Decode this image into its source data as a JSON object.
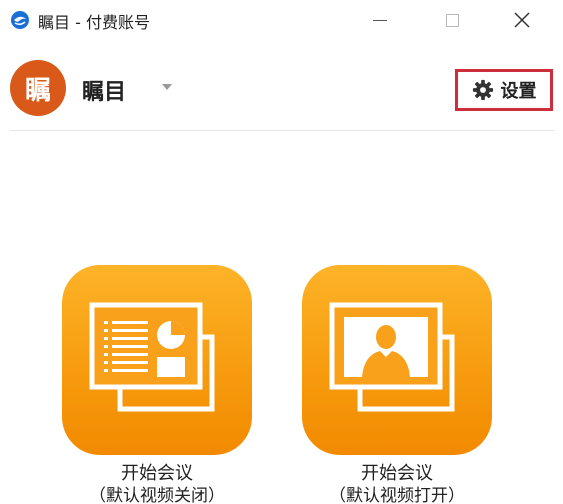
{
  "window": {
    "title": "瞩目 - 付费账号"
  },
  "user": {
    "avatar_text": "瞩",
    "avatar_color": "#d9591a",
    "name": "瞩目"
  },
  "toolbar": {
    "settings_label": "设置",
    "highlight_color": "#cc2e3b"
  },
  "actions": [
    {
      "title": "开始会议",
      "subtitle": "（默认视频关闭）",
      "icon": "presentation-screen-icon"
    },
    {
      "title": "开始会议",
      "subtitle": "（默认视频打开）",
      "icon": "video-person-screen-icon"
    }
  ],
  "colors": {
    "tile_top": "#fdb328",
    "tile_bottom": "#f28a00",
    "app_icon": "#1a6fd4"
  }
}
